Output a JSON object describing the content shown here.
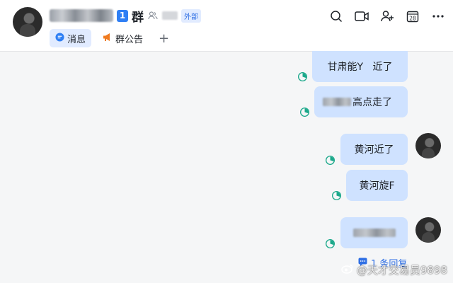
{
  "header": {
    "member_count_badge": "1",
    "group_label": "群",
    "external_badge": "外部",
    "tabs": [
      {
        "label": "消息",
        "icon": "chat-bubble-icon",
        "active": true
      },
      {
        "label": "群公告",
        "icon": "megaphone-icon",
        "active": false
      }
    ],
    "add_tab_label": "+",
    "toolbar": [
      "search-icon",
      "video-call-icon",
      "add-member-icon",
      "calendar-icon",
      "more-icon"
    ],
    "calendar_day": "28"
  },
  "messages": [
    {
      "text": "甘肃能Y   近了"
    },
    {
      "text": "高点走了"
    },
    {
      "text": "黄河近了"
    },
    {
      "text": "黄河旋F"
    },
    {
      "text": ""
    }
  ],
  "reply": {
    "label": "1 条回复"
  },
  "watermark": {
    "label": "@天才交易员9898"
  },
  "colors": {
    "accent": "#2f7ff4",
    "bubble": "#cfe2ff",
    "read_receipt": "#1aa88a"
  }
}
